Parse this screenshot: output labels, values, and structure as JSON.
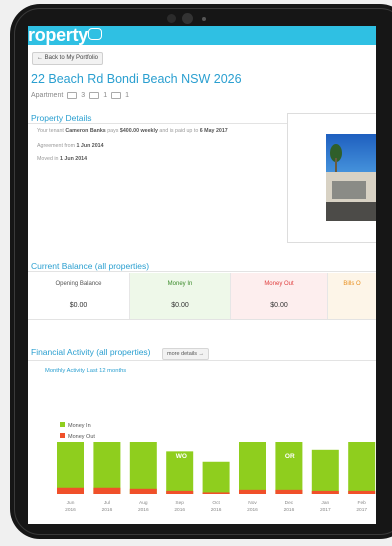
{
  "app": {
    "brand": "roperty"
  },
  "nav": {
    "back_label": "← Back to My Portfolio"
  },
  "property": {
    "address": "22 Beach Rd Bondi Beach NSW 2026",
    "type": "Apartment",
    "beds": "3",
    "baths": "1",
    "parking": "1"
  },
  "details": {
    "heading": "Property Details",
    "tenant_prefix": "Your tenant",
    "tenant_name": "Cameron Banks",
    "pays_label": "pays",
    "rent": "$400.00 weekly",
    "paid_label": "and is paid up to",
    "paid_up_to": "6 May 2017",
    "agreement_label": "Agreement from",
    "agreement_from": "1 Jun 2014",
    "moved_label": "Moved in",
    "moved_in": "1 Jun 2014"
  },
  "balance": {
    "heading": "Current Balance (all properties)",
    "cards": [
      {
        "label": "Opening Balance",
        "value": "$0.00",
        "color": "#555555",
        "bg": "#ffffff"
      },
      {
        "label": "Money In",
        "value": "$0.00",
        "color": "#3a8a2a",
        "bg": "#eef8e9"
      },
      {
        "label": "Money Out",
        "value": "$0.00",
        "color": "#e04040",
        "bg": "#fdeeee"
      },
      {
        "label": "Bills O",
        "value": "",
        "color": "#e89020",
        "bg": "#fdf5e8"
      }
    ]
  },
  "activity": {
    "heading": "Financial Activity (all properties)",
    "more_label": "more details →",
    "subheading": "Monthly Activity Last 12 months"
  },
  "chart_data": {
    "type": "bar",
    "stacked": true,
    "categories": [
      "Jun\n2016",
      "Jul\n2016",
      "Aug\n2016",
      "Sep\n2016",
      "Oct\n2016",
      "Nov\n2016",
      "Dec\n2016",
      "Jan\n2017",
      "Feb\n2017"
    ],
    "series": [
      {
        "name": "Money In",
        "color": "#8fce1e",
        "values": [
          1.0,
          1.0,
          1.0,
          0.82,
          0.62,
          1.0,
          1.0,
          0.85,
          1.0
        ]
      },
      {
        "name": "Money Out",
        "color": "#f0502a",
        "values": [
          0.12,
          0.12,
          0.1,
          0.06,
          0.03,
          0.08,
          0.08,
          0.06,
          0.06
        ]
      }
    ],
    "bar_text": [
      "",
      "",
      "",
      "WO",
      "",
      "",
      "OR",
      "",
      ""
    ],
    "legend_position": "top-left",
    "grid": false
  }
}
